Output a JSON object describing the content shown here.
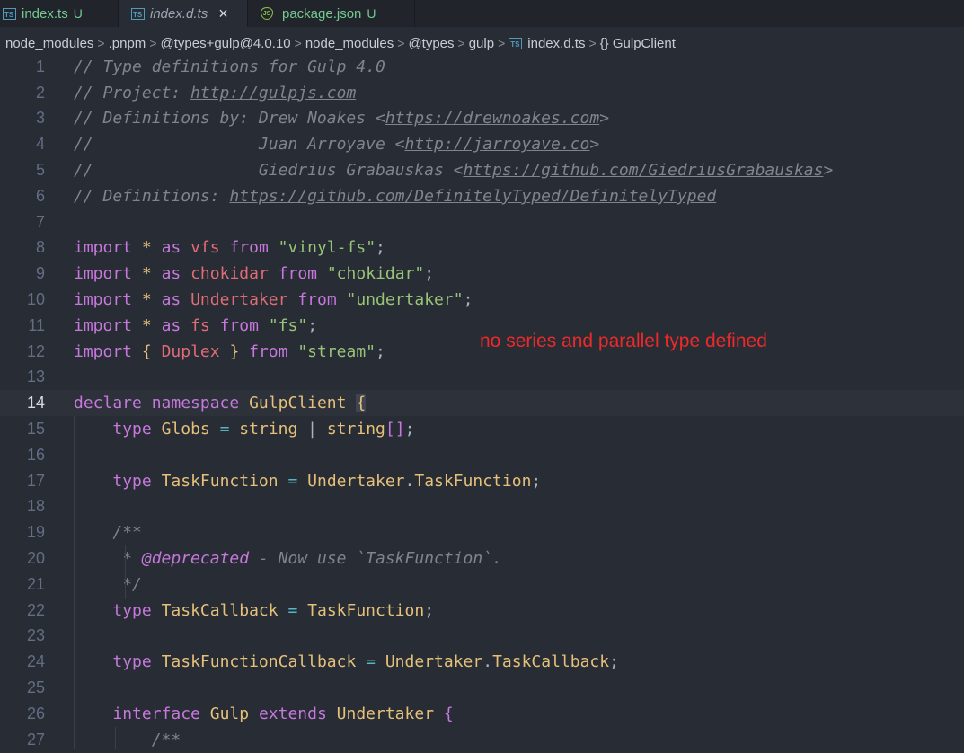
{
  "tabs": [
    {
      "name": "index.ts",
      "badge": "U",
      "icon": "typescript-icon",
      "icon_text": "TS"
    },
    {
      "name": "index.d.ts",
      "close": "×",
      "icon": "typescript-icon",
      "icon_text": "TS"
    },
    {
      "name": "package.json",
      "badge": "U",
      "icon": "node-js-icon",
      "icon_text": "JS"
    }
  ],
  "breadcrumb": {
    "items": [
      "node_modules",
      ".pnpm",
      "@types+gulp@4.0.10",
      "node_modules",
      "@types",
      "gulp",
      "index.d.ts",
      "{} GulpClient"
    ],
    "separator": ">"
  },
  "line_numbers": [
    "1",
    "2",
    "3",
    "4",
    "5",
    "6",
    "7",
    "8",
    "9",
    "10",
    "11",
    "12",
    "13",
    "14",
    "15",
    "16",
    "17",
    "18",
    "19",
    "20",
    "21",
    "22",
    "23",
    "24",
    "25",
    "26",
    "27"
  ],
  "code": {
    "l1": "// Type definitions for Gulp 4.0",
    "l2a": "// Project: ",
    "l2b": "http://gulpjs.com",
    "l3a": "// Definitions by: Drew Noakes <",
    "l3b": "https://drewnoakes.com",
    "l3c": ">",
    "l4a": "//                 Juan Arroyave <",
    "l4b": "http://jarroyave.co",
    "l4c": ">",
    "l5a": "//                 Giedrius Grabauskas <",
    "l5b": "https://github.com/GiedriusGrabauskas",
    "l5c": ">",
    "l6a": "// Definitions: ",
    "l6b": "https://github.com/DefinitelyTyped/DefinitelyTyped",
    "import": "import",
    "star": "*",
    "as": "as",
    "from": "from",
    "vfs": "vfs",
    "vfs_mod": "\"vinyl-fs\"",
    "chokidar": "chokidar",
    "chokidar_mod": "\"chokidar\"",
    "undertaker": "Undertaker",
    "undertaker_mod": "\"undertaker\"",
    "fs": "fs",
    "fs_mod": "\"fs\"",
    "lbrace": "{",
    "rbrace": "}",
    "duplex": "Duplex",
    "stream_mod": "\"stream\"",
    "semi": ";",
    "declare": "declare",
    "namespace": "namespace",
    "gulpclient": "GulpClient",
    "type": "type",
    "globs": "Globs",
    "eq": "=",
    "string": "string",
    "pipe": "|",
    "brackets": "[]",
    "taskfunction": "TaskFunction",
    "dot": ".",
    "doc_open": "/**",
    "doc_star": " * ",
    "deprecated": "@deprecated",
    "doc_text": " - Now use `TaskFunction`.",
    "doc_close": " */",
    "taskcallback": "TaskCallback",
    "taskfunctioncallback": "TaskFunctionCallback",
    "interface": "interface",
    "gulp": "Gulp",
    "extends": "extends",
    "doc_open2": "/**"
  },
  "annotation": "no series and parallel type defined"
}
